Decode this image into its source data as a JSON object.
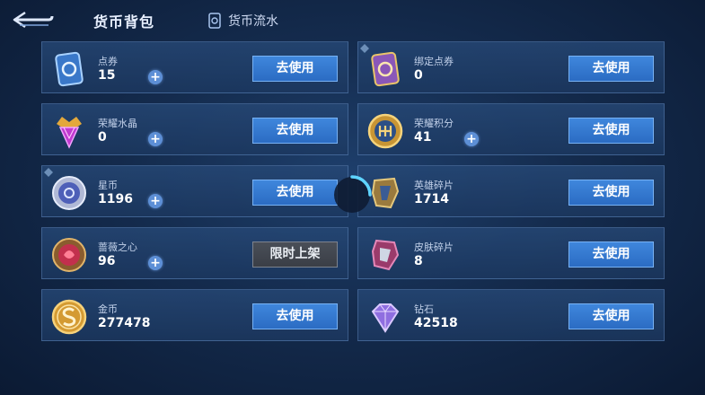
{
  "header": {
    "title": "货币背包",
    "flow_label": "货币流水"
  },
  "use_label": "去使用",
  "limited_label": "限时上架",
  "currencies": [
    {
      "name": "点券",
      "value": "15"
    },
    {
      "name": "绑定点券",
      "value": "0"
    },
    {
      "name": "荣耀水晶",
      "value": "0"
    },
    {
      "name": "荣耀积分",
      "value": "41"
    },
    {
      "name": "星币",
      "value": "1196"
    },
    {
      "name": "英雄碎片",
      "value": "1714"
    },
    {
      "name": "蔷薇之心",
      "value": "96"
    },
    {
      "name": "皮肤碎片",
      "value": "8"
    },
    {
      "name": "金币",
      "value": "277478"
    },
    {
      "name": "钻石",
      "value": "42518"
    }
  ],
  "colors": {
    "accent_button": "#2f74cc",
    "plus_button": "#5d8fd6",
    "limited_button": "#42464e"
  }
}
